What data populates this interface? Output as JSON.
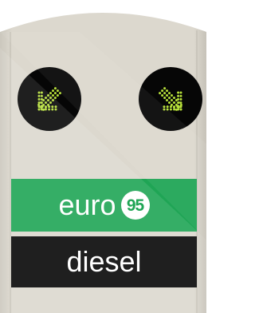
{
  "sign": {
    "colors": {
      "panel": "#d9d5cb",
      "green": "#1fa555",
      "black": "#060606",
      "arrow": "#b7e03a"
    },
    "arrows": {
      "left_icon": "arrow-down-left-icon",
      "right_icon": "arrow-down-right-icon"
    },
    "fuels": {
      "euro_label": "euro",
      "octane": "95",
      "diesel_label": "diesel"
    }
  }
}
